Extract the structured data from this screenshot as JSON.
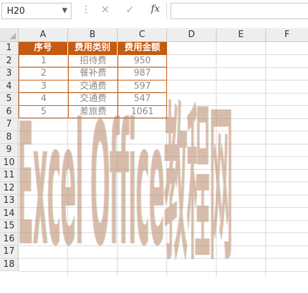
{
  "formula_bar": {
    "name_box": "H20",
    "cancel_icon": "✕",
    "enter_icon": "✓",
    "fx_label": "fx",
    "formula": ""
  },
  "columns": [
    "A",
    "B",
    "C",
    "D",
    "E",
    "F"
  ],
  "rows": [
    "1",
    "2",
    "3",
    "4",
    "5",
    "6",
    "7",
    "8",
    "9",
    "10",
    "11",
    "12",
    "13",
    "14",
    "15",
    "16",
    "17",
    "18"
  ],
  "table": {
    "headers": [
      "序号",
      "费用类别",
      "费用金额"
    ],
    "rows": [
      [
        "1",
        "招待费",
        "950"
      ],
      [
        "2",
        "餐补费",
        "987"
      ],
      [
        "3",
        "交通费",
        "597"
      ],
      [
        "4",
        "交通费",
        "547"
      ],
      [
        "5",
        "差旅费",
        "1061"
      ]
    ]
  },
  "watermark": "Excel Office教程网",
  "colors": {
    "header_bg": "#c55a11",
    "header_text": "#ffffff",
    "border": "#c55a11",
    "cell_text": "#8a8a8a"
  }
}
